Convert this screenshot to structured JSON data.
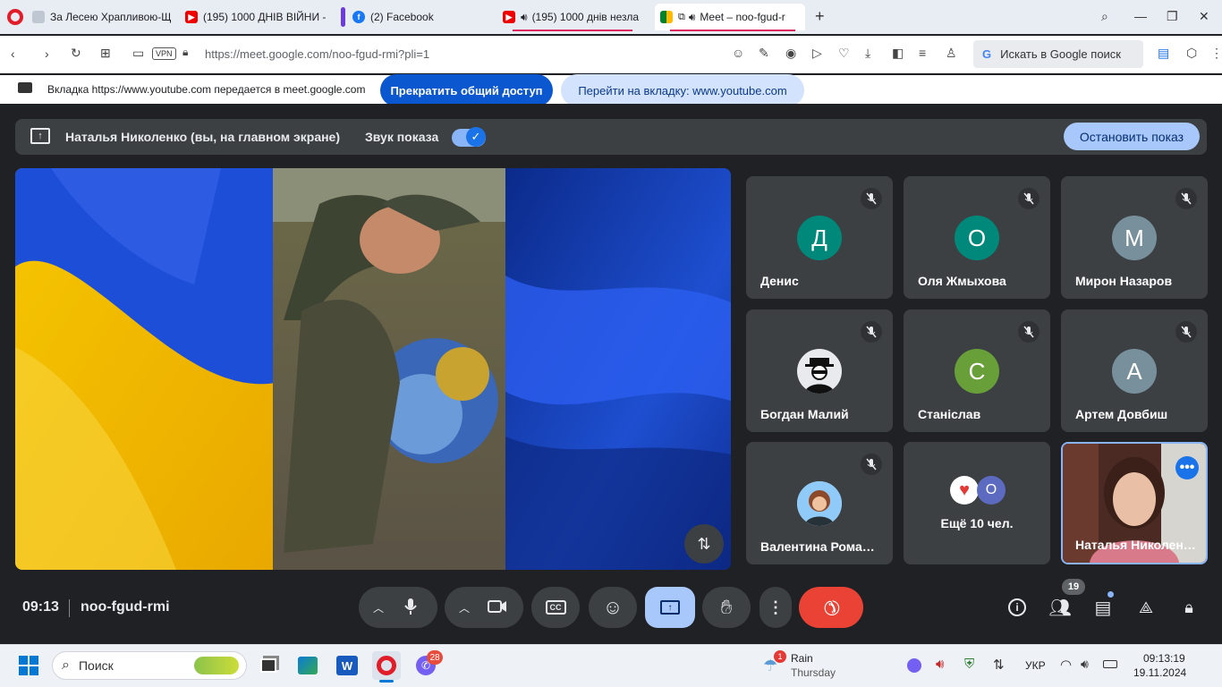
{
  "browser": {
    "tabs": [
      {
        "label": "За Лесею Храпливою-Щ"
      },
      {
        "label": "(195) 1000 ДНІВ ВІЙНИ -"
      },
      {
        "label": "(2) Facebook"
      },
      {
        "label": "(195) 1000 днів незла"
      },
      {
        "label": "Meet – noo-fgud-r"
      }
    ],
    "url": "https://meet.google.com/noo-fgud-rmi?pli=1",
    "vpn_label": "VPN",
    "search_placeholder": "Искать в Google поиск"
  },
  "banner": {
    "text": "Вкладка https://www.youtube.com передается в meet.google.com",
    "stop_share_label": "Прекратить общий доступ",
    "switch_tab_label": "Перейти на вкладку: www.youtube.com"
  },
  "sharebar": {
    "presenter_label": "Наталья Николенко (вы, на главном экране)",
    "audio_label": "Звук показа",
    "audio_enabled": true,
    "stop_label": "Остановить показ"
  },
  "participants": [
    {
      "name": "Денис",
      "initial": "Д",
      "color": "#00897b",
      "muted": true
    },
    {
      "name": "Оля Жмыхова",
      "initial": "О",
      "color": "#00897b",
      "muted": true
    },
    {
      "name": "Мирон Назаров",
      "initial": "М",
      "color": "#78909c",
      "muted": true
    },
    {
      "name": "Богдан Малий",
      "initial": "",
      "color": "#e8eaed",
      "muted": true
    },
    {
      "name": "Станіслав",
      "initial": "С",
      "color": "#689f38",
      "muted": true
    },
    {
      "name": "Артем Довбиш",
      "initial": "А",
      "color": "#78909c",
      "muted": true
    },
    {
      "name": "Валентина Роман…",
      "initial": "",
      "color": "#cfd8dc",
      "muted": true
    }
  ],
  "more_tile": {
    "label": "Ещё 10 чел.",
    "avatar_initial": "О"
  },
  "self_tile": {
    "name": "Наталья Николен…"
  },
  "meeting": {
    "time": "09:13",
    "code": "noo-fgud-rmi",
    "people_count": "19"
  },
  "taskbar": {
    "search_label": "Поиск",
    "viber_badge": "28",
    "weather_badge": "1",
    "weather_title": "Rain",
    "weather_day": "Thursday",
    "language": "УКР",
    "time": "09:13:19",
    "date": "19.11.2024"
  },
  "colors": {
    "accent": "#1a73e8",
    "end_call": "#ea4335",
    "present_active": "#a8c7fa",
    "meet_bg": "#202124"
  }
}
